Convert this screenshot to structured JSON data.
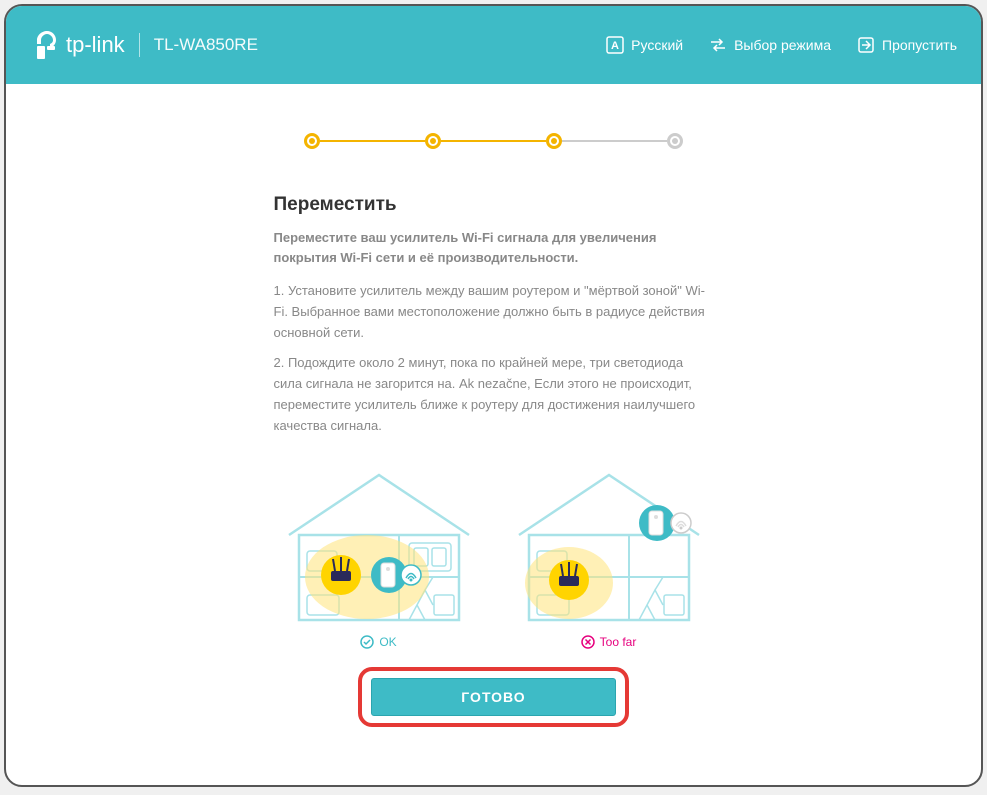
{
  "header": {
    "brand": "tp-link",
    "model": "TL-WA850RE",
    "language": "Русский",
    "mode_select": "Выбор режима",
    "skip": "Пропустить"
  },
  "page": {
    "title": "Переместить",
    "subtitle": "Переместите ваш усилитель Wi-Fi сигнала для увеличения покрытия Wi-Fi сети и её производительности.",
    "instruction1": "1. Установите усилитель между вашим роутером и \"мёртвой зоной\" Wi-Fi. Выбранное вами местоположение должно быть в радиусе действия основной сети.",
    "instruction2": "2. Подождите около 2 минут, пока по крайней мере, три светодиода сила сигнала не загорится на. Ak nezačne, Если этого не происходит, переместите усилитель ближе к роутеру для достижения наилучшего качества сигнала."
  },
  "diagrams": {
    "ok_label": "OK",
    "bad_label": "Too far"
  },
  "button": {
    "done": "ГОТОВО"
  }
}
